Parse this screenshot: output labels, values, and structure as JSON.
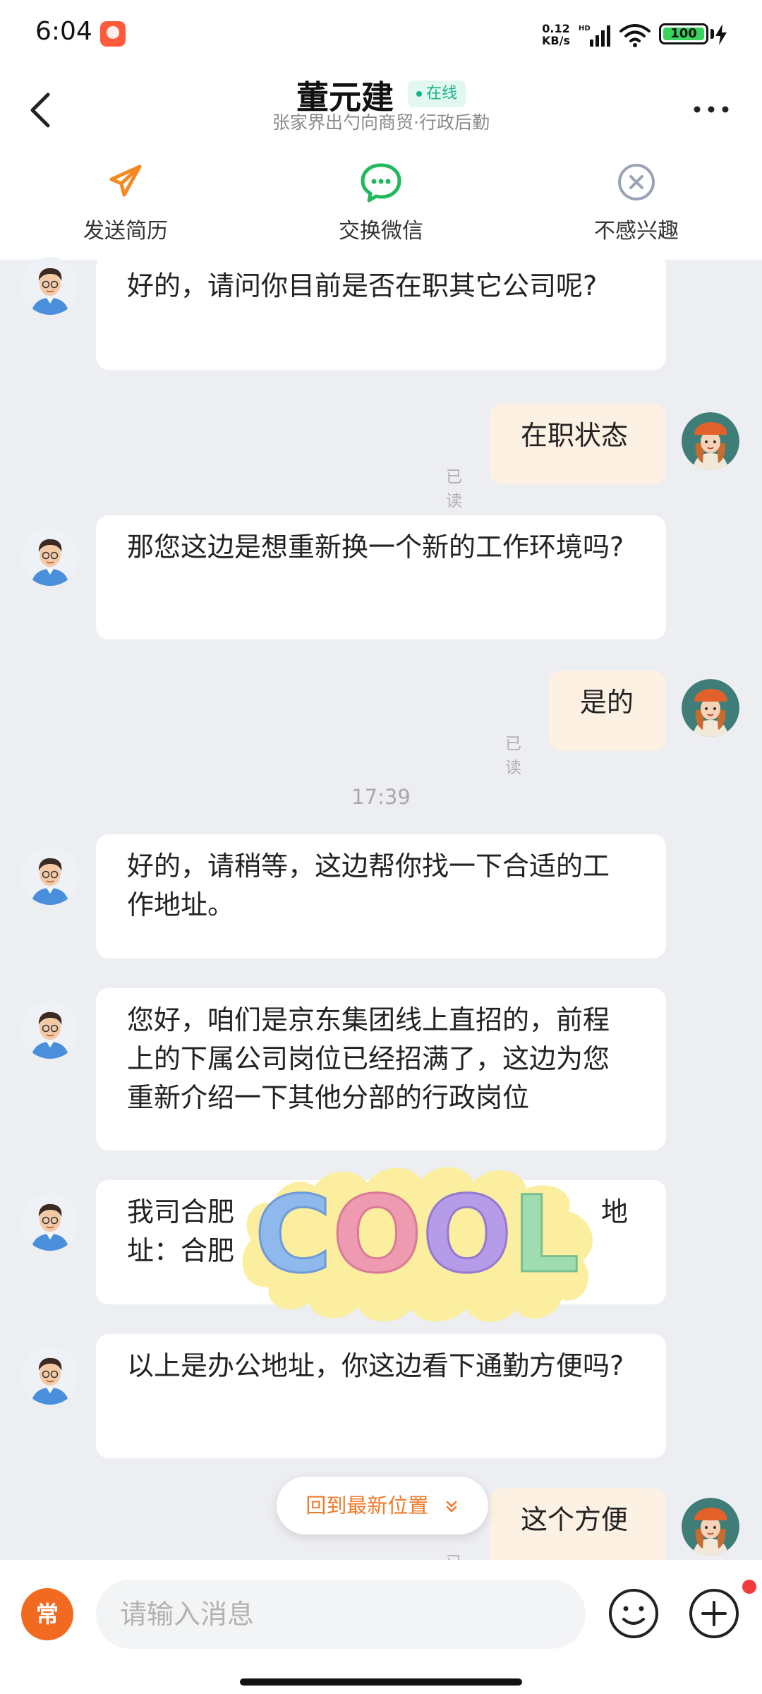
{
  "status_bar": {
    "time": "6:04",
    "net_speed_value": "0.12",
    "net_speed_unit": "KB/s",
    "signal_tag": "HD",
    "battery": "100",
    "icons": [
      "app-notification-icon",
      "signal-icon",
      "wifi-icon",
      "battery-icon",
      "charging-icon"
    ]
  },
  "header": {
    "name": "董元建",
    "online_label": "在线",
    "subtitle": "张家界出勺向商贸·行政后勤",
    "actions": [
      {
        "label": "发送简历",
        "icon": "paper-plane-icon",
        "color": "#f5891f"
      },
      {
        "label": "交换微信",
        "icon": "wechat-icon",
        "color": "#20b95c"
      },
      {
        "label": "不感兴趣",
        "icon": "close-circle-icon",
        "color": "#9aa3b5"
      }
    ]
  },
  "messages": [
    {
      "side": "in",
      "text": "好的，请问你目前是否在职其它公司呢?"
    },
    {
      "side": "out",
      "text": "在职状态",
      "status": "已读"
    },
    {
      "side": "in",
      "text": "那您这边是想重新换一个新的工作环境吗?"
    },
    {
      "side": "out",
      "text": "是的",
      "status": "已读"
    },
    {
      "side": "in",
      "text": "好的，请稍等，这边帮你找一下合适的工作地址。"
    },
    {
      "side": "in",
      "text": "您好，咱们是京东集团线上直招的，前程上的下属公司岗位已经招满了，这边为您重新介绍一下其他分部的行政岗位"
    },
    {
      "side": "in",
      "text": "我司合肥",
      "text_right": "地",
      "text_line2": "址：合肥"
    },
    {
      "side": "in",
      "text": "以上是办公地址，你这边看下通勤方便吗?"
    },
    {
      "side": "out",
      "text": "这个方便",
      "status": "已读"
    }
  ],
  "time_divider": "17:39",
  "sticker": {
    "text": "COOL",
    "letter_colors": [
      "#8fb8ec",
      "#ee9bb2",
      "#b59be8",
      "#9fdcb0"
    ],
    "blob_color": "#fbee9e"
  },
  "jump_button": {
    "label": "回到最新位置"
  },
  "input_bar": {
    "common_label": "常",
    "placeholder": "请输入消息",
    "value": ""
  },
  "colors": {
    "accent": "#f26a1f",
    "online": "#14b38a",
    "outgoing_bubble": "#fdf1e4",
    "background": "#edeef2"
  }
}
